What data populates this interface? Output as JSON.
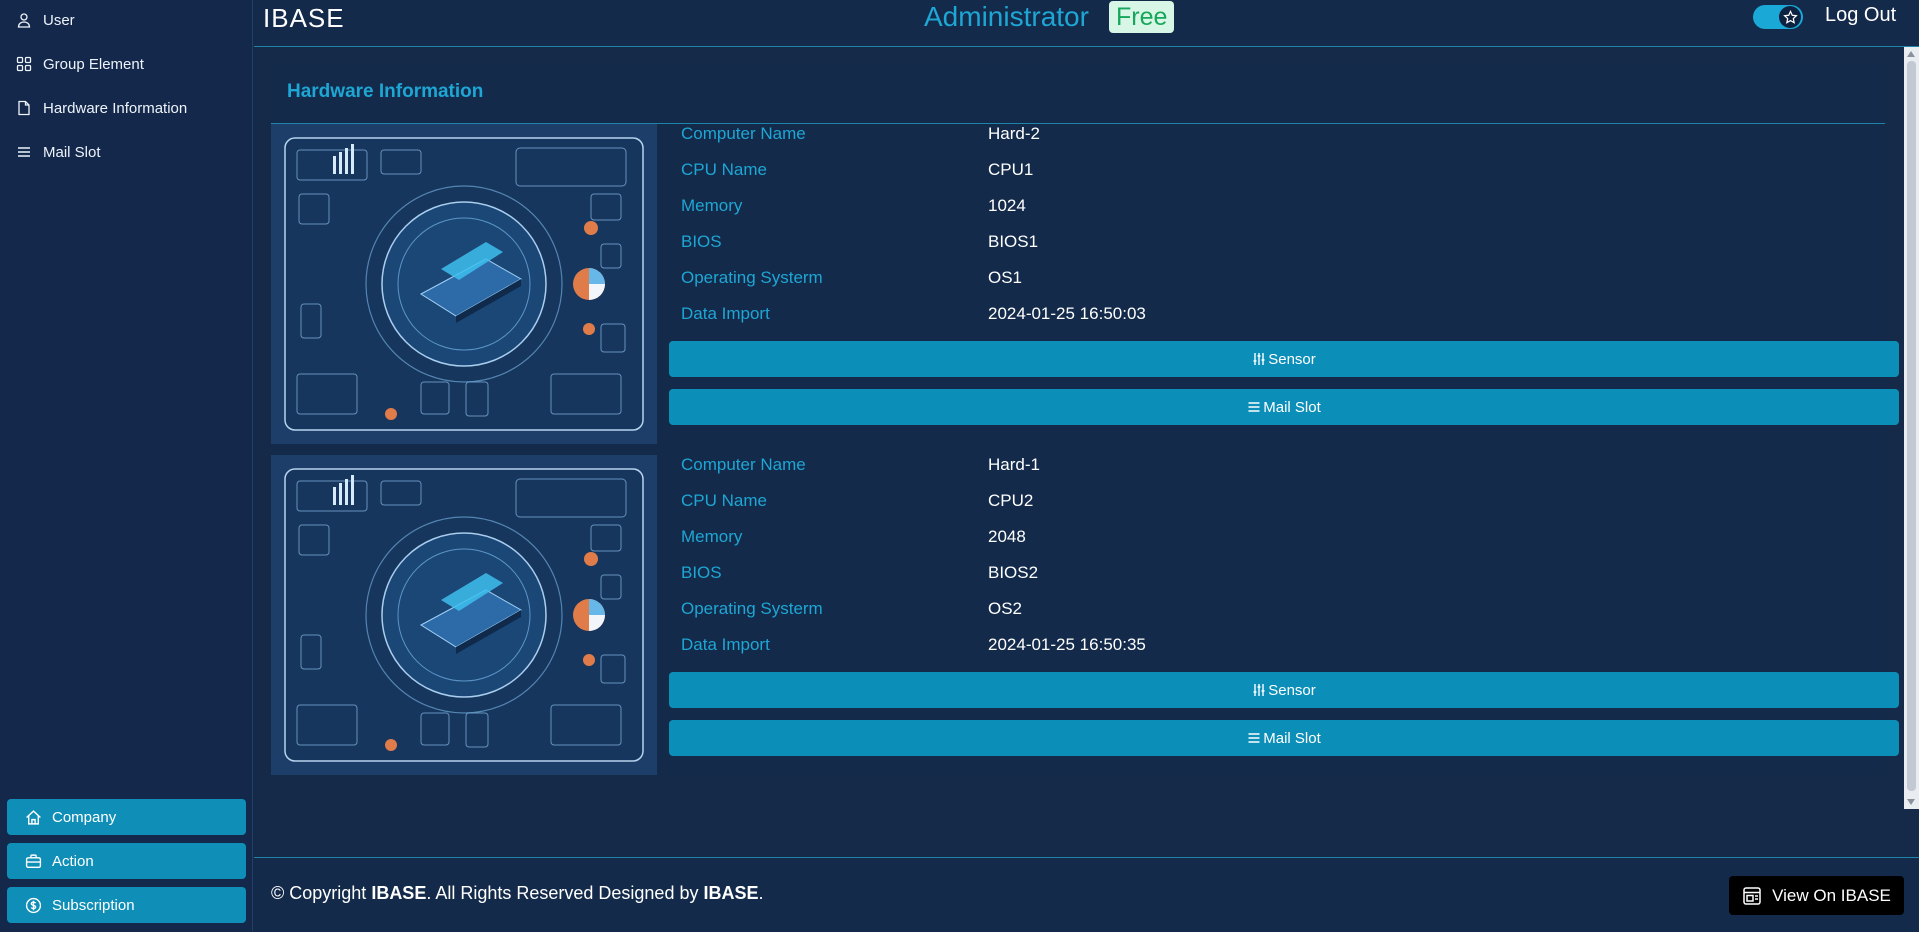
{
  "sidebar": {
    "nav": [
      {
        "label": "User",
        "icon": "user-icon"
      },
      {
        "label": "Group Element",
        "icon": "grid-icon"
      },
      {
        "label": "Hardware Information",
        "icon": "document-icon"
      },
      {
        "label": "Mail Slot",
        "icon": "list-icon"
      }
    ],
    "bottom_buttons": [
      {
        "label": "Company",
        "icon": "home-icon"
      },
      {
        "label": "Action",
        "icon": "briefcase-icon"
      },
      {
        "label": "Subscription",
        "icon": "dollar-circle-icon"
      }
    ]
  },
  "header": {
    "brand": "IBASE",
    "role": "Administrator",
    "plan_badge": "Free",
    "logout_label": "Log Out"
  },
  "main": {
    "title": "Hardware Information",
    "field_labels": {
      "computer_name": "Computer Name",
      "cpu_name": "CPU Name",
      "memory": "Memory",
      "bios": "BIOS",
      "os": "Operating Systerm",
      "data_import": "Data Import"
    },
    "hardware": [
      {
        "computer_name": "Hard-2",
        "cpu_name": "CPU1",
        "memory": "1024",
        "bios": "BIOS1",
        "os": "OS1",
        "data_import": "2024-01-25 16:50:03",
        "sensor_label": "Sensor",
        "mailslot_label": "Mail Slot"
      },
      {
        "computer_name": "Hard-1",
        "cpu_name": "CPU2",
        "memory": "2048",
        "bios": "BIOS2",
        "os": "OS2",
        "data_import": "2024-01-25 16:50:35",
        "sensor_label": "Sensor",
        "mailslot_label": "Mail Slot"
      }
    ]
  },
  "footer": {
    "copyright_prefix": "© Copyright ",
    "copyright_brand": "IBASE",
    "copyright_middle": ". All Rights Reserved Designed by ",
    "designer": "IBASE",
    "copyright_suffix": ".",
    "view_button": "View On IBASE"
  },
  "colors": {
    "background": "#152a48",
    "accent": "#1ea6d4",
    "button": "#0b8fb8",
    "badge_bg": "#d8f6e6",
    "badge_text": "#17a65b"
  }
}
